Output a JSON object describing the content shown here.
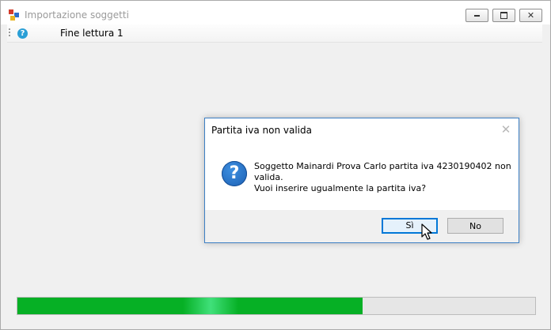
{
  "window": {
    "title": "Importazione soggetti",
    "controls": {
      "minimize": "—",
      "maximize": "▭",
      "close": "✕"
    }
  },
  "statusbar": {
    "text": "Fine lettura 1"
  },
  "progress": {
    "fraction": 0.667,
    "fill_color": "#06b025"
  },
  "dialog": {
    "title": "Partita iva non valida",
    "close_glyph": "✕",
    "message": [
      "Soggetto Mainardi Prova Carlo partita iva 4230190402 non",
      "valida.",
      "Vuoi inserire ugualmente la partita iva?"
    ],
    "buttons": {
      "yes": "Sì",
      "no": "No"
    }
  },
  "colors": {
    "accent": "#0078d7",
    "icon_blue": "#1c5fb3",
    "help_icon": "#2a9fd6",
    "app_icon_red": "#d23a2a",
    "app_icon_blue": "#2c6fc9",
    "app_icon_yellow": "#e8b523"
  }
}
